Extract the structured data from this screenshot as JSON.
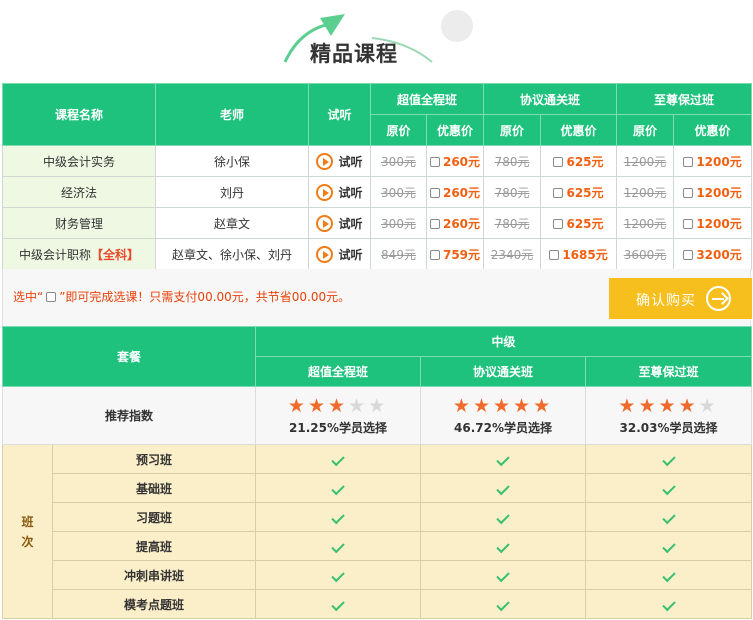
{
  "header": {
    "title": "精品课程"
  },
  "price_table": {
    "headers": {
      "course": "课程名称",
      "teacher": "老师",
      "trial": "试听",
      "orig": "原价",
      "sale": "优惠价"
    },
    "packages": [
      "超值全程班",
      "协议通关班",
      "至尊保过班"
    ],
    "trial_label": "试听",
    "rows": [
      {
        "course": "中级会计实务",
        "highlight": "",
        "teacher": "徐小保",
        "prices": [
          {
            "orig": "300元",
            "sale": "260元"
          },
          {
            "orig": "780元",
            "sale": "625元"
          },
          {
            "orig": "1200元",
            "sale": "1200元"
          }
        ]
      },
      {
        "course": "经济法",
        "highlight": "",
        "teacher": "刘丹",
        "prices": [
          {
            "orig": "300元",
            "sale": "260元"
          },
          {
            "orig": "780元",
            "sale": "625元"
          },
          {
            "orig": "1200元",
            "sale": "1200元"
          }
        ]
      },
      {
        "course": "财务管理",
        "highlight": "",
        "teacher": "赵章文",
        "prices": [
          {
            "orig": "300元",
            "sale": "260元"
          },
          {
            "orig": "780元",
            "sale": "625元"
          },
          {
            "orig": "1200元",
            "sale": "1200元"
          }
        ]
      },
      {
        "course": "中级会计职称",
        "highlight": "【全科】",
        "teacher": "赵章文、徐小保、刘丹",
        "prices": [
          {
            "orig": "849元",
            "sale": "759元"
          },
          {
            "orig": "2340元",
            "sale": "1685元"
          },
          {
            "orig": "3600元",
            "sale": "3200元"
          }
        ]
      }
    ]
  },
  "select_bar": {
    "prefix": "选中“",
    "suffix": "”即可完成选课！只需支付00.00元，共节省00.00元。",
    "buy_label": "确认购买"
  },
  "package_table": {
    "set_label": "套餐",
    "level_label": "中级",
    "packages": [
      "超值全程班",
      "协议通关班",
      "至尊保过班"
    ],
    "rating_label": "推荐指数",
    "ratings": [
      {
        "stars": 3,
        "max": 5,
        "text": "21.25%学员选择"
      },
      {
        "stars": 5,
        "max": 5,
        "text": "46.72%学员选择"
      },
      {
        "stars": 4,
        "max": 5,
        "text": "32.03%学员选择"
      }
    ],
    "group_label": "班次",
    "classes": [
      {
        "name": "预习班",
        "included": [
          true,
          true,
          true
        ]
      },
      {
        "name": "基础班",
        "included": [
          true,
          true,
          true
        ]
      },
      {
        "name": "习题班",
        "included": [
          true,
          true,
          true
        ]
      },
      {
        "name": "提高班",
        "included": [
          true,
          true,
          true
        ]
      },
      {
        "name": "冲刺串讲班",
        "included": [
          true,
          true,
          true
        ]
      },
      {
        "name": "模考点题班",
        "included": [
          true,
          true,
          true
        ]
      }
    ]
  },
  "colors": {
    "accent_green": "#1ec27c",
    "sale_orange": "#f06012",
    "star_orange": "#f06a2c",
    "buy_yellow": "#f7bf1e",
    "row_cream": "#fbefc9"
  }
}
